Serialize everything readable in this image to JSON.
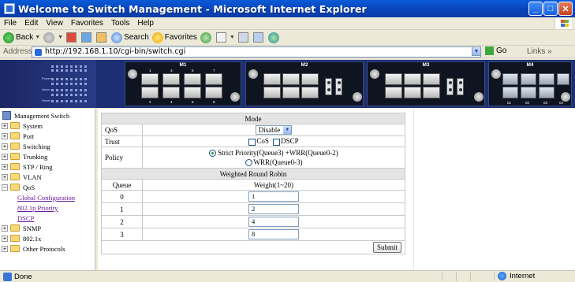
{
  "window": {
    "title": "Welcome to Switch Management - Microsoft Internet Explorer",
    "minimize_glyph": "_",
    "maximize_glyph": "□",
    "close_glyph": "✕"
  },
  "menu": [
    "File",
    "Edit",
    "View",
    "Favorites",
    "Tools",
    "Help"
  ],
  "toolbar": {
    "back": "Back",
    "search": "Search",
    "favorites": "Favorites"
  },
  "address": {
    "label": "Address",
    "url": "http://192.168.1.10/cgi-bin/switch.cgi",
    "go": "Go",
    "links": "Links »"
  },
  "panel": {
    "modules": [
      "M1",
      "M2",
      "M3",
      "M4"
    ],
    "m1_ports_top": [
      "1",
      "3",
      "5",
      "7"
    ],
    "m1_ports_bottom": [
      "2",
      "4",
      "6",
      "8"
    ],
    "m4_ports": [
      "01",
      "02",
      "03",
      "04"
    ],
    "led_labels": [
      "Power",
      "Alarm",
      "Reset"
    ]
  },
  "tree": {
    "root": "Management Switch",
    "items": [
      {
        "label": "System",
        "expanded": false
      },
      {
        "label": "Port",
        "expanded": false
      },
      {
        "label": "Switching",
        "expanded": false
      },
      {
        "label": "Trunking",
        "expanded": false
      },
      {
        "label": "STP / Ring",
        "expanded": false
      },
      {
        "label": "VLAN",
        "expanded": false
      },
      {
        "label": "QoS",
        "expanded": true
      },
      {
        "label": "SNMP",
        "expanded": false
      },
      {
        "label": "802.1x",
        "expanded": false
      },
      {
        "label": "Other Protocols",
        "expanded": false
      }
    ],
    "qos_children": [
      "Global Configuration",
      "802.1p Priority",
      "DSCP"
    ]
  },
  "form": {
    "mode_header": "Mode",
    "qos_label": "QoS",
    "qos_value": "Disable",
    "trust_label": "Trust",
    "cos_label": "CoS",
    "dscp_label": "DSCP",
    "policy_label": "Policy",
    "policy_option1": "Strict Priority(Queue3) +WRR(Queue0-2)",
    "policy_option2": "WRR(Queue0-3)",
    "wrr_header": "Weighted Round Robin",
    "queue_header": "Queue",
    "weight_header": "Weight(1~20)",
    "queues": [
      {
        "queue": "0",
        "weight": "1"
      },
      {
        "queue": "1",
        "weight": "2"
      },
      {
        "queue": "2",
        "weight": "4"
      },
      {
        "queue": "3",
        "weight": "8"
      }
    ],
    "submit": "Submit"
  },
  "status": {
    "text": "Done",
    "zone": "Internet"
  }
}
